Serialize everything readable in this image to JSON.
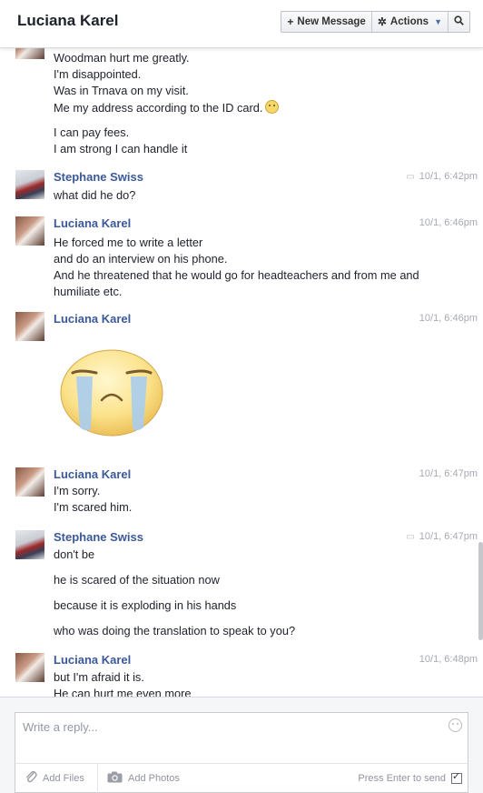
{
  "header": {
    "title": "Luciana Karel",
    "new_message_label": "New Message",
    "actions_label": "Actions"
  },
  "messages": [
    {
      "sender": "",
      "time": "",
      "lines": [
        "Woodman hurt me greatly.",
        "I'm disappointed.",
        "Was in Trnava on my visit.",
        "Me my address according to the ID card.",
        "I can pay fees.",
        "I am strong I can handle it"
      ]
    },
    {
      "sender": "Stephane Swiss",
      "time": "10/1, 6:42pm",
      "lines": [
        "what did he do?"
      ]
    },
    {
      "sender": "Luciana Karel",
      "time": "10/1, 6:46pm",
      "lines": [
        "He forced me to write a letter",
        "and do an interview on his phone.",
        "And he threatened that he would go for headteachers and from me and",
        "humiliate etc."
      ]
    },
    {
      "sender": "Luciana Karel",
      "time": "10/1, 6:46pm",
      "lines": []
    },
    {
      "sender": "Luciana Karel",
      "time": "10/1, 6:47pm",
      "lines": [
        "I'm sorry.",
        "I'm scared him."
      ]
    },
    {
      "sender": "Stephane Swiss",
      "time": "10/1, 6:47pm",
      "lines": [
        "don't be",
        "he is scared of the situation now",
        "because it is exploding in his hands",
        "who was doing the translation to speak to you?"
      ]
    },
    {
      "sender": "Luciana Karel",
      "time": "10/1, 6:48pm",
      "lines": [
        "but I'm afraid it is.",
        "He can hurt me even more"
      ]
    }
  ],
  "composer": {
    "placeholder": "Write a reply...",
    "add_files_label": "Add Files",
    "add_photos_label": "Add Photos",
    "enter_label": "Press Enter to send",
    "enter_to_send": true
  },
  "icons": {
    "new_message": "plus-icon",
    "actions": "gear-icon",
    "search": "search-icon",
    "attach": "paperclip-icon",
    "camera": "camera-icon",
    "emoji": "smiley-icon",
    "chat": "chat-bubble-icon",
    "sticker": "crying-face-sticker"
  },
  "colors": {
    "sender_name": "#3b5998",
    "timestamp": "#a6a9b0",
    "composer_bg": "#f5f6f7"
  }
}
